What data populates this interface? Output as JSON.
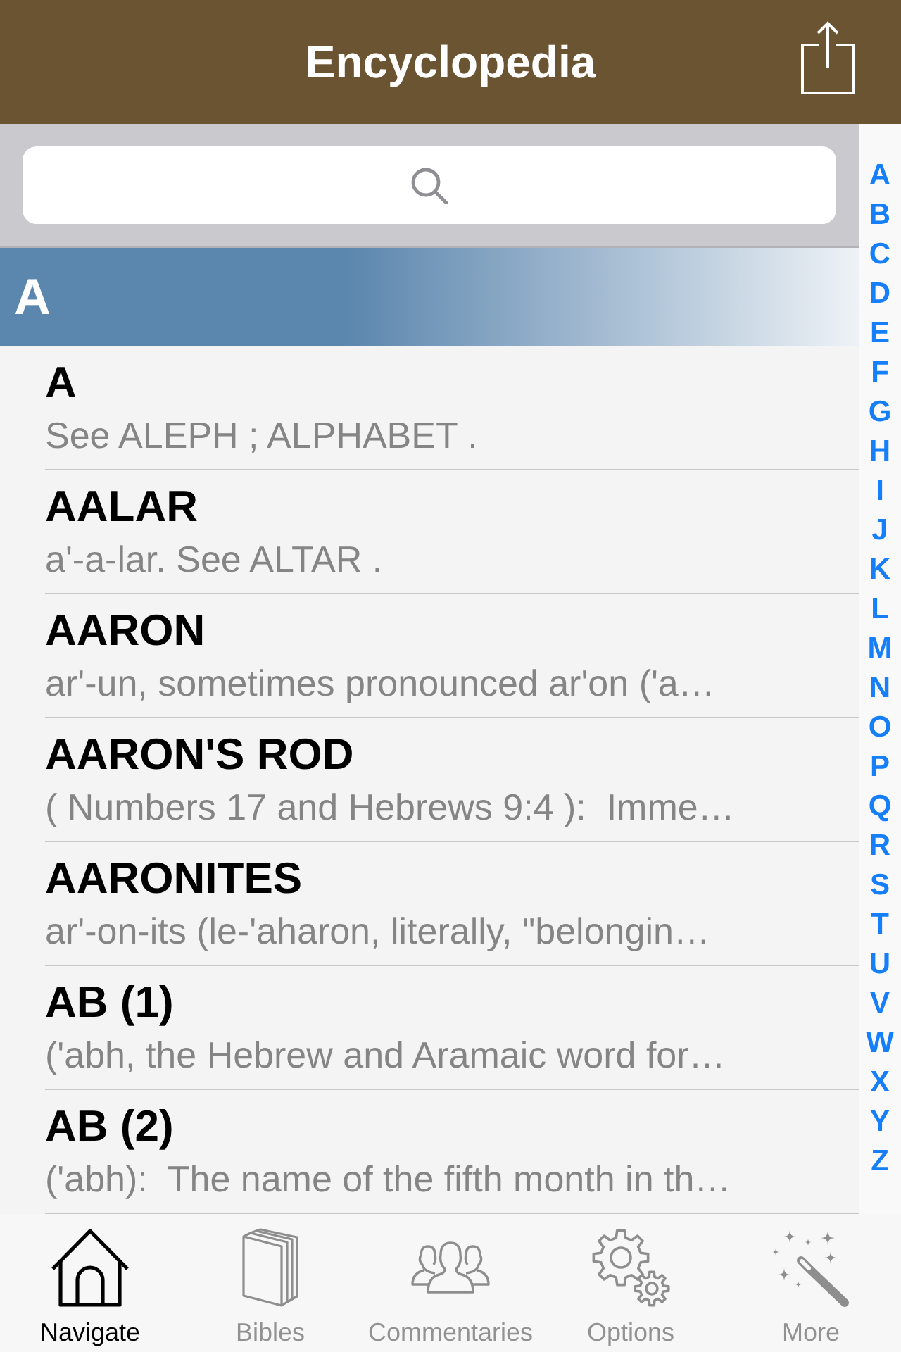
{
  "nav_bar": {
    "title": "Encyclopedia"
  },
  "section": {
    "header": "A",
    "entries": [
      {
        "term": "A",
        "summary": "See ALEPH ; ALPHABET ."
      },
      {
        "term": "AALAR",
        "summary": "a'-a-lar. See ALTAR ."
      },
      {
        "term": "AARON",
        "summary": "ar'-un, sometimes pronounced ar'on ('a…"
      },
      {
        "term": "AARON'S ROD",
        "summary": "( Numbers 17 and Hebrews 9:4 ):  Imme…"
      },
      {
        "term": "AARONITES",
        "summary": "ar'-on-its (le-'aharon, literally, \"belongin…"
      },
      {
        "term": "AB (1)",
        "summary": "('abh, the Hebrew and Aramaic word for…"
      },
      {
        "term": "AB (2)",
        "summary": "('abh):  The name of the fifth month in th…"
      }
    ]
  },
  "index": [
    "A",
    "B",
    "C",
    "D",
    "E",
    "F",
    "G",
    "H",
    "I",
    "J",
    "K",
    "L",
    "M",
    "N",
    "O",
    "P",
    "Q",
    "R",
    "S",
    "T",
    "U",
    "V",
    "W",
    "X",
    "Y",
    "Z"
  ],
  "tab_bar": [
    {
      "label": "Navigate",
      "kind": "house",
      "selected": true
    },
    {
      "label": "Bibles",
      "kind": "books",
      "selected": false
    },
    {
      "label": "Commentaries",
      "kind": "people",
      "selected": false
    },
    {
      "label": "Options",
      "kind": "gears",
      "selected": false
    },
    {
      "label": "More",
      "kind": "wand",
      "selected": false
    }
  ]
}
